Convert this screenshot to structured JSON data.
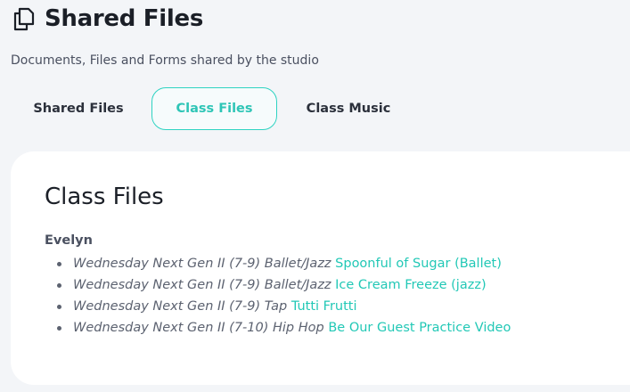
{
  "header": {
    "title": "Shared Files",
    "icon": "copy-files-icon",
    "subtitle": "Documents, Files and Forms shared by the studio"
  },
  "tabs": [
    {
      "label": "Shared Files",
      "active": false
    },
    {
      "label": "Class Files",
      "active": true
    },
    {
      "label": "Class Music",
      "active": false
    }
  ],
  "colors": {
    "accent": "#2ed3c2",
    "link": "#22c8b6",
    "background": "#f3f5f8",
    "card": "#ffffff"
  },
  "section": {
    "title": "Class Files",
    "groups": [
      {
        "name": "Evelyn",
        "files": [
          {
            "class": "Wednesday Next Gen II (7-9) Ballet/Jazz",
            "link": "Spoonful of Sugar (Ballet)"
          },
          {
            "class": "Wednesday Next Gen II (7-9) Ballet/Jazz",
            "link": "Ice Cream Freeze (jazz)"
          },
          {
            "class": "Wednesday Next Gen II (7-9) Tap",
            "link": "Tutti Frutti"
          },
          {
            "class": "Wednesday Next Gen II (7-10) Hip Hop",
            "link": "Be Our Guest Practice Video"
          }
        ]
      }
    ]
  }
}
